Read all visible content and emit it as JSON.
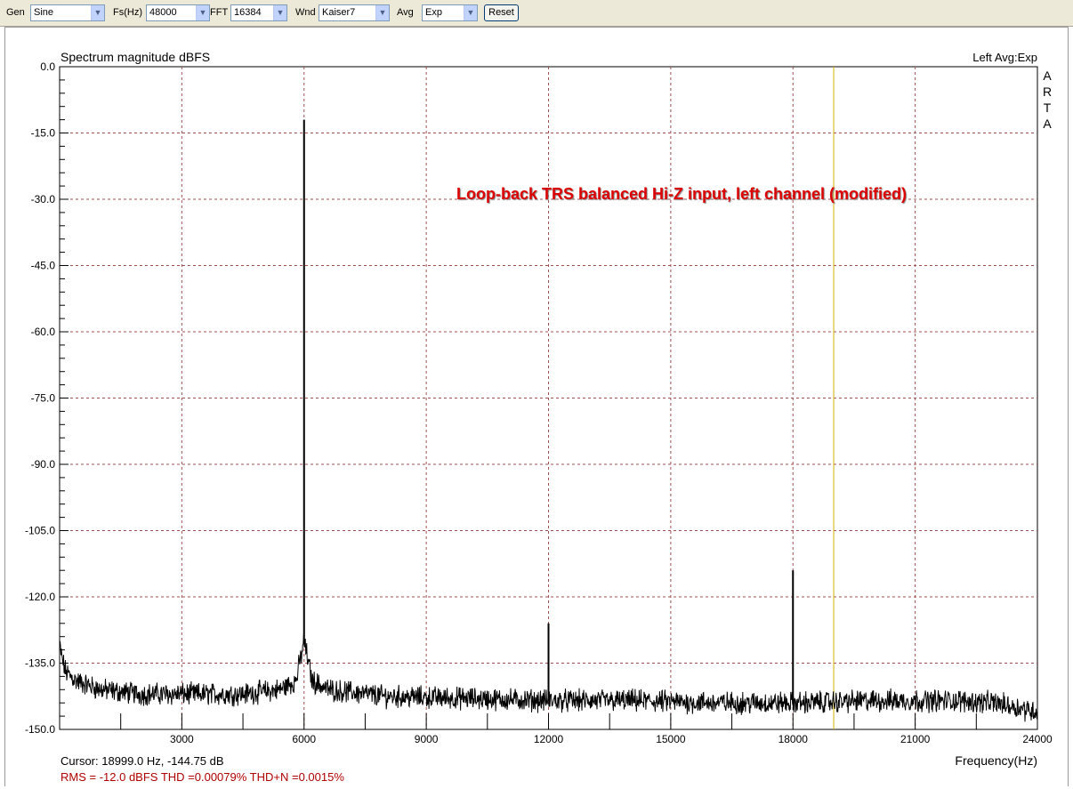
{
  "toolbar": {
    "gen_label": "Gen",
    "gen_value": "Sine",
    "fs_label": "Fs(Hz)",
    "fs_value": "48000",
    "fft_label": "FFT",
    "fft_value": "16384",
    "wnd_label": "Wnd",
    "wnd_value": "Kaiser7",
    "avg_label": "Avg",
    "avg_value": "Exp",
    "reset_label": "Reset"
  },
  "colors": {
    "grid": "#a05050",
    "trace": "#000000",
    "cursor": "#d4b300",
    "annotation": "#dd0000",
    "stats": "#b00000"
  },
  "chart_data": {
    "type": "line",
    "title": "Spectrum magnitude dBFS",
    "top_right_label": "Left  Avg:Exp",
    "side_label": [
      "A",
      "R",
      "T",
      "A"
    ],
    "xlabel": "Frequency(Hz)",
    "ylabel": "",
    "xlim": [
      0,
      24000
    ],
    "ylim": [
      -150,
      0
    ],
    "xticks": [
      3000,
      6000,
      9000,
      12000,
      15000,
      18000,
      21000,
      24000
    ],
    "xtick_labels": [
      "3000",
      "6000",
      "9000",
      "12000",
      "15000",
      "18000",
      "21000",
      "24000"
    ],
    "yticks": [
      0,
      -15,
      -30,
      -45,
      -60,
      -75,
      -90,
      -105,
      -120,
      -135,
      -150
    ],
    "ytick_labels": [
      "0.0",
      "-15.0",
      "-30.0",
      "-45.0",
      "-60.0",
      "-75.0",
      "-90.0",
      "-105.0",
      "-120.0",
      "-135.0",
      "-150.0"
    ],
    "grid": true,
    "annotation": "Loop-back TRS balanced Hi-Z input, left channel (modified)",
    "cursor_x": 19000,
    "cursor_readout": "Cursor: 18999.0 Hz, -144.75 dB",
    "stats": "RMS =  -12.0 dBFS   THD =0.00079%   THD+N =0.0015%",
    "series": [
      {
        "noise_floor_points": [
          [
            0,
            -131
          ],
          [
            60,
            -134
          ],
          [
            150,
            -137
          ],
          [
            400,
            -139
          ],
          [
            1000,
            -141
          ],
          [
            2000,
            -142
          ],
          [
            3000,
            -142
          ],
          [
            4500,
            -142
          ],
          [
            5400,
            -141
          ],
          [
            5800,
            -139
          ],
          [
            6000,
            -130
          ],
          [
            6200,
            -139
          ],
          [
            6600,
            -141
          ],
          [
            8000,
            -142.5
          ],
          [
            10000,
            -143
          ],
          [
            12000,
            -143.5
          ],
          [
            14000,
            -143.5
          ],
          [
            16000,
            -144
          ],
          [
            18000,
            -144
          ],
          [
            20000,
            -143.5
          ],
          [
            22000,
            -143.5
          ],
          [
            23000,
            -144
          ],
          [
            24000,
            -146
          ]
        ],
        "peaks": [
          {
            "x": 6000,
            "y": -12
          },
          {
            "x": 12000,
            "y": -126
          },
          {
            "x": 18000,
            "y": -114
          }
        ]
      }
    ]
  }
}
